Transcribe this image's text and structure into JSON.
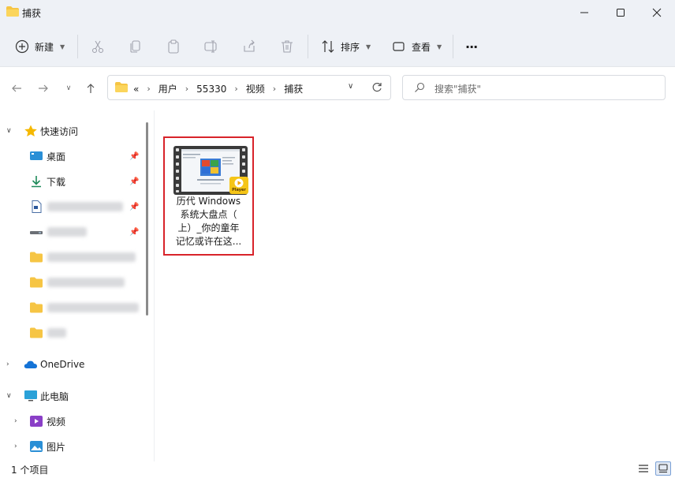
{
  "window": {
    "title": "捕获"
  },
  "toolbar": {
    "new_label": "新建",
    "sort_label": "排序",
    "view_label": "查看",
    "more_label": "···"
  },
  "address": {
    "overflow": "«",
    "crumbs": [
      "用户",
      "55330",
      "视频",
      "捕获"
    ]
  },
  "search": {
    "placeholder": "搜索\"捕获\""
  },
  "sidebar": {
    "quick_access": "快速访问",
    "desktop": "桌面",
    "downloads": "下载",
    "onedrive": "OneDrive",
    "this_pc": "此电脑",
    "videos": "视频",
    "pictures": "图片"
  },
  "file": {
    "name_lines": [
      "历代 Windows",
      "系统大盘点（",
      "上）_你的童年",
      "记忆或许在这..."
    ],
    "badge": "Player"
  },
  "status": {
    "count": "1 个项目"
  },
  "colors": {
    "accent": "#0067c0",
    "highlight_border": "#d8232a",
    "folder": "#f6c544"
  }
}
